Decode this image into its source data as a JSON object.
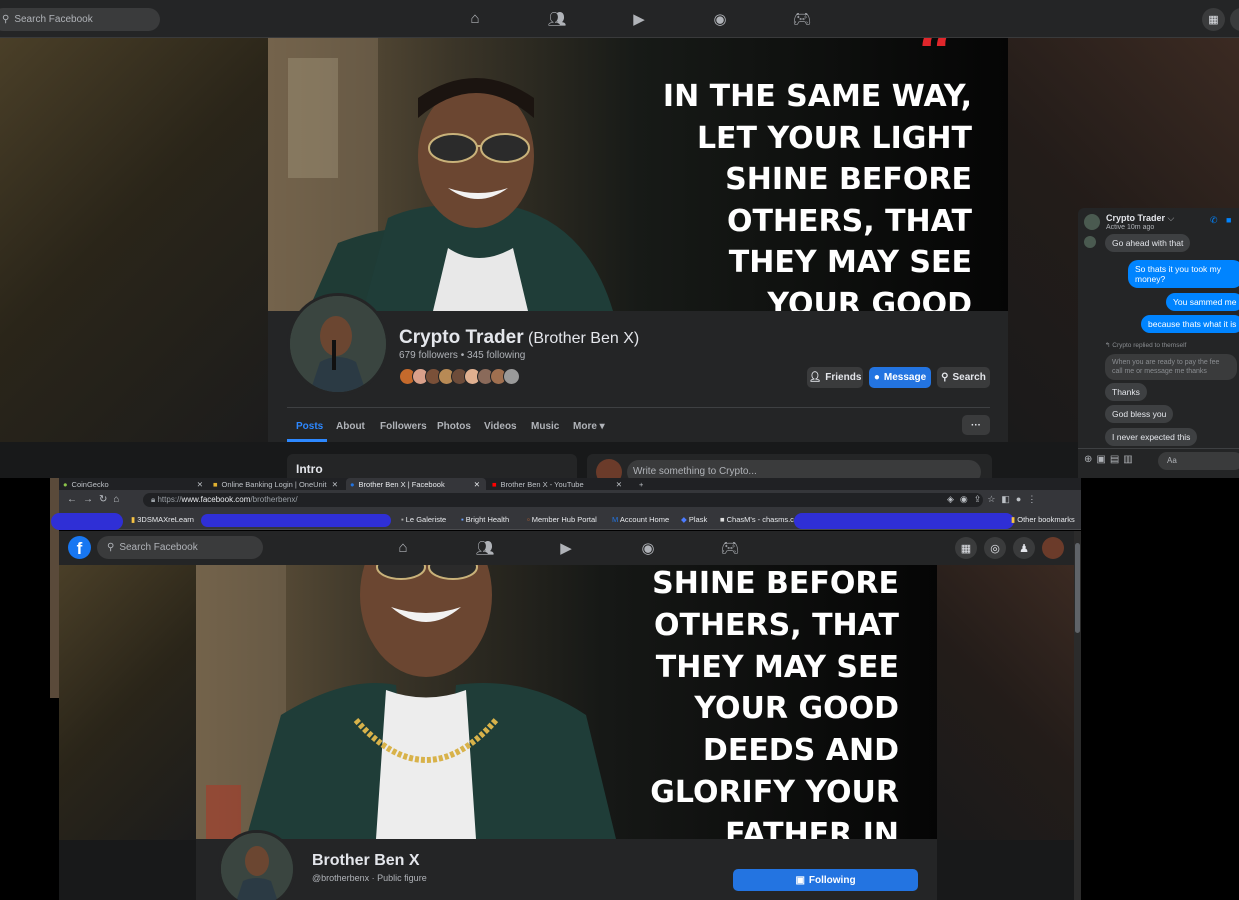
{
  "top": {
    "nav": {
      "search_placeholder": "Search Facebook"
    },
    "cover_quote": [
      "IN THE SAME WAY,",
      "LET YOUR LIGHT",
      "SHINE BEFORE",
      "OTHERS, THAT",
      "THEY MAY SEE",
      "YOUR GOOD"
    ],
    "profile": {
      "name": "Crypto Trader",
      "alt_name": "(Brother Ben X)",
      "stats": "679 followers • 345 following",
      "buttons": {
        "friends": "Friends",
        "message": "Message",
        "search": "Search",
        "more": "···"
      }
    },
    "tabs": [
      "Posts",
      "About",
      "Followers",
      "Photos",
      "Videos",
      "Music",
      "More ▾"
    ],
    "intro_title": "Intro",
    "composer_placeholder": "Write something to Crypto...",
    "chat": {
      "name": "Crypto Trader",
      "status": "Active 10m ago",
      "messages": [
        {
          "from": "them",
          "text": "Go ahead with that"
        },
        {
          "from": "me",
          "text": "So thats it you took my money?"
        },
        {
          "from": "me",
          "text": "You sammed me"
        },
        {
          "from": "me",
          "text": "because thats what it is"
        },
        {
          "from": "note",
          "text": "↰ Crypto replied to themself"
        },
        {
          "from": "quoted",
          "text": "When you are ready to pay the fee call me or message me thanks"
        },
        {
          "from": "them",
          "text": "Thanks"
        },
        {
          "from": "them",
          "text": "God bless you"
        },
        {
          "from": "them",
          "text": "I never expected this"
        }
      ],
      "input_placeholder": "Aa"
    }
  },
  "bottom": {
    "browser_tabs": [
      {
        "label": "CoinGecko",
        "active": false
      },
      {
        "label": "Online Banking Login | OneUnit",
        "active": false
      },
      {
        "label": "Brother Ben X | Facebook",
        "active": true
      },
      {
        "label": "Brother Ben X - YouTube",
        "active": false
      }
    ],
    "new_tab": "+",
    "url_prefix": "https://",
    "url_host": "www.facebook.com",
    "url_path": "/brotherbenx/",
    "bookmarks": [
      "3DSMAXreLearn",
      "Le Galeriste",
      "Bright Health",
      "Member Hub Portal",
      "Account Home",
      "Plask",
      "ChasM's - chasms.c",
      "Other bookmarks"
    ],
    "nav": {
      "search_placeholder": "Search Facebook"
    },
    "cover_quote": [
      "SHINE BEFORE",
      "OTHERS, THAT",
      "THEY MAY SEE",
      "YOUR GOOD",
      "DEEDS AND",
      "GLORIFY YOUR",
      "FATHER IN"
    ],
    "profile": {
      "name": "Brother Ben X",
      "handle": "@brotherbenx · Public figure",
      "following_button": "Following"
    }
  },
  "colors": {
    "facebook_blue": "#2374e1",
    "messenger_blue": "#0084ff",
    "quote_mark_red": "#e0262b",
    "redaction_blue": "#2f2fd6"
  }
}
